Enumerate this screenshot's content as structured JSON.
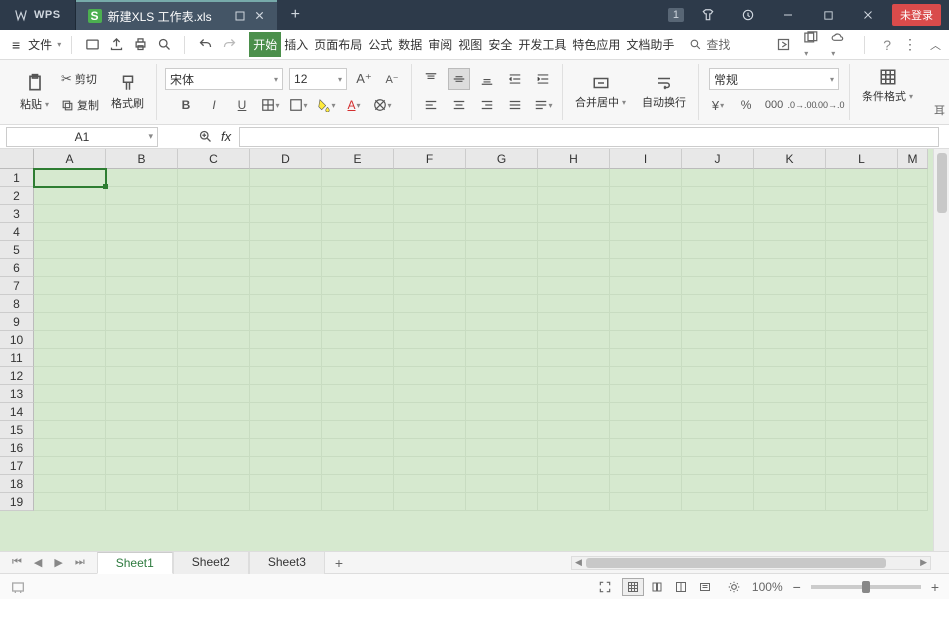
{
  "titlebar": {
    "app": "WPS",
    "doc_name": "新建XLS 工作表.xls",
    "badge": "1",
    "login": "未登录"
  },
  "menubar": {
    "file": "文件",
    "tabs": [
      "开始",
      "插入",
      "页面布局",
      "公式",
      "数据",
      "审阅",
      "视图",
      "安全",
      "开发工具",
      "特色应用",
      "文档助手"
    ],
    "search": "查找"
  },
  "ribbon": {
    "paste": "粘贴",
    "cut": "剪切",
    "copy": "复制",
    "fmt_painter": "格式刷",
    "font_name": "宋体",
    "font_size": "12",
    "merge": "合并居中",
    "wrap": "自动换行",
    "number_format": "常规",
    "cond_fmt": "条件格式"
  },
  "namebox": "A1",
  "columns": [
    "A",
    "B",
    "C",
    "D",
    "E",
    "F",
    "G",
    "H",
    "I",
    "J",
    "K",
    "L"
  ],
  "rows": [
    "1",
    "2",
    "3",
    "4",
    "5",
    "6",
    "7",
    "8",
    "9",
    "10",
    "11",
    "12",
    "13",
    "14",
    "15",
    "16",
    "17",
    "18",
    "19"
  ],
  "sheets": [
    "Sheet1",
    "Sheet2",
    "Sheet3"
  ],
  "active_sheet": 0,
  "status": {
    "zoom": "100%"
  }
}
